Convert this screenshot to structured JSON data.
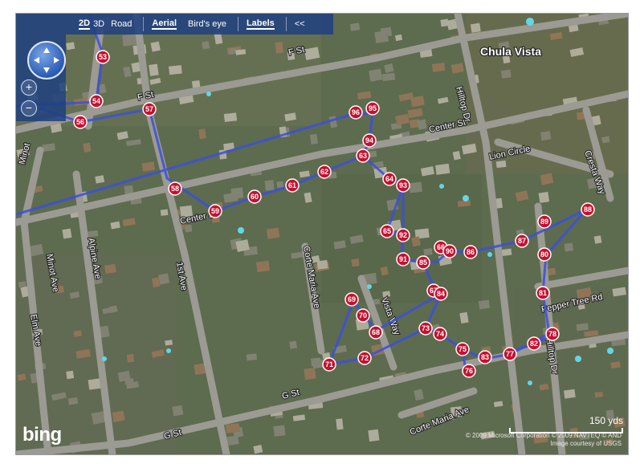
{
  "toolbar": {
    "view_2d": "2D",
    "view_3d": "3D",
    "road": "Road",
    "aerial": "Aerial",
    "birds_eye": "Bird's eye",
    "labels": "Labels",
    "collapse": "<<"
  },
  "nav": {
    "zoom_in": "+",
    "zoom_out": "−"
  },
  "map": {
    "city_label": "Chula Vista",
    "streets": [
      {
        "name": "F St"
      },
      {
        "name": "F St"
      },
      {
        "name": "Center St"
      },
      {
        "name": "Center St"
      },
      {
        "name": "Lion Circle"
      },
      {
        "name": "Cresta Way"
      },
      {
        "name": "Hilltop Dr"
      },
      {
        "name": "Hilltop Dr"
      },
      {
        "name": "Minot"
      },
      {
        "name": "Minot Ave"
      },
      {
        "name": "Alpine Ave"
      },
      {
        "name": "Elm Ave"
      },
      {
        "name": "1st Ave"
      },
      {
        "name": "Corte Maria Ave"
      },
      {
        "name": "Vista Way"
      },
      {
        "name": "Pepper Tree Rd"
      },
      {
        "name": "G St"
      },
      {
        "name": "G St"
      },
      {
        "name": "Corte Maria Ave"
      }
    ],
    "waypoints": [
      {
        "num": "53"
      },
      {
        "num": "54"
      },
      {
        "num": "56"
      },
      {
        "num": "57"
      },
      {
        "num": "58"
      },
      {
        "num": "59"
      },
      {
        "num": "60"
      },
      {
        "num": "61"
      },
      {
        "num": "62"
      },
      {
        "num": "63"
      },
      {
        "num": "64"
      },
      {
        "num": "65"
      },
      {
        "num": "66"
      },
      {
        "num": "67"
      },
      {
        "num": "68"
      },
      {
        "num": "69"
      },
      {
        "num": "70"
      },
      {
        "num": "71"
      },
      {
        "num": "72"
      },
      {
        "num": "73"
      },
      {
        "num": "74"
      },
      {
        "num": "75"
      },
      {
        "num": "76"
      },
      {
        "num": "77"
      },
      {
        "num": "78"
      },
      {
        "num": "80"
      },
      {
        "num": "81"
      },
      {
        "num": "82"
      },
      {
        "num": "83"
      },
      {
        "num": "84"
      },
      {
        "num": "85"
      },
      {
        "num": "86"
      },
      {
        "num": "87"
      },
      {
        "num": "88"
      },
      {
        "num": "89"
      },
      {
        "num": "90"
      },
      {
        "num": "91"
      },
      {
        "num": "92"
      },
      {
        "num": "93"
      },
      {
        "num": "94"
      },
      {
        "num": "95"
      },
      {
        "num": "96"
      }
    ]
  },
  "scale": {
    "label": "150 yds"
  },
  "attribution": {
    "line1": "© 2009 Microsoft Corporation  © 2009 NAVTEQ  © AND",
    "line2": "Image courtesy of USGS"
  },
  "logo": "bing",
  "colors": {
    "route": "#3a4fe0",
    "marker_fill": "#c8102e",
    "toolbar": "#1f4080"
  }
}
